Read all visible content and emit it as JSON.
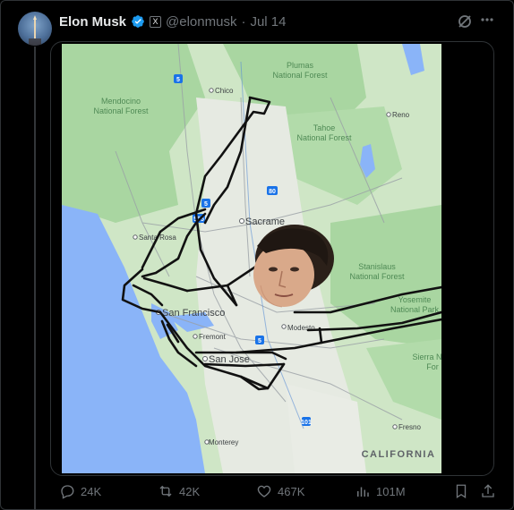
{
  "tweet": {
    "author_name": "Elon Musk",
    "handle": "@elonmusk",
    "separator": "·",
    "date": "Jul 14",
    "badge_letter": "X"
  },
  "map": {
    "labels": {
      "plumas": "Plumas",
      "plumas2": "National Forest",
      "chico": "Chico",
      "reno": "Reno",
      "mendocino": "Mendocino",
      "mendocino2": "National Forest",
      "tahoe": "Tahoe",
      "tahoe2": "National Forest",
      "sacramento": "Sacrame",
      "santa_rosa": "Santa Rosa",
      "stanislaus": "Stanislaus",
      "stanislaus2": "National Forest",
      "san_francisco": "San Francisco",
      "yosemite": "Yosemite",
      "yosemite2": "National Park",
      "modesto": "Modesto",
      "fremont": "Fremont",
      "san_jose": "San Jose",
      "sierra": "Sierra N",
      "sierra2": "For",
      "fresno": "Fresno",
      "monterey": "Monterey",
      "california": "CALIFORNIA",
      "hw5a": "5",
      "hw80": "80",
      "hw505": "505",
      "hw5b": "5",
      "hw5c": "5",
      "hw101": "101"
    },
    "colors": {
      "ocean": "#8ab4f8",
      "land": "#c9e4c1",
      "forest": "#a8d5a3",
      "valley": "#e8ece6",
      "drawing": "#111111"
    }
  },
  "actions": {
    "replies": "24K",
    "reposts": "42K",
    "likes": "467K",
    "views": "101M"
  }
}
